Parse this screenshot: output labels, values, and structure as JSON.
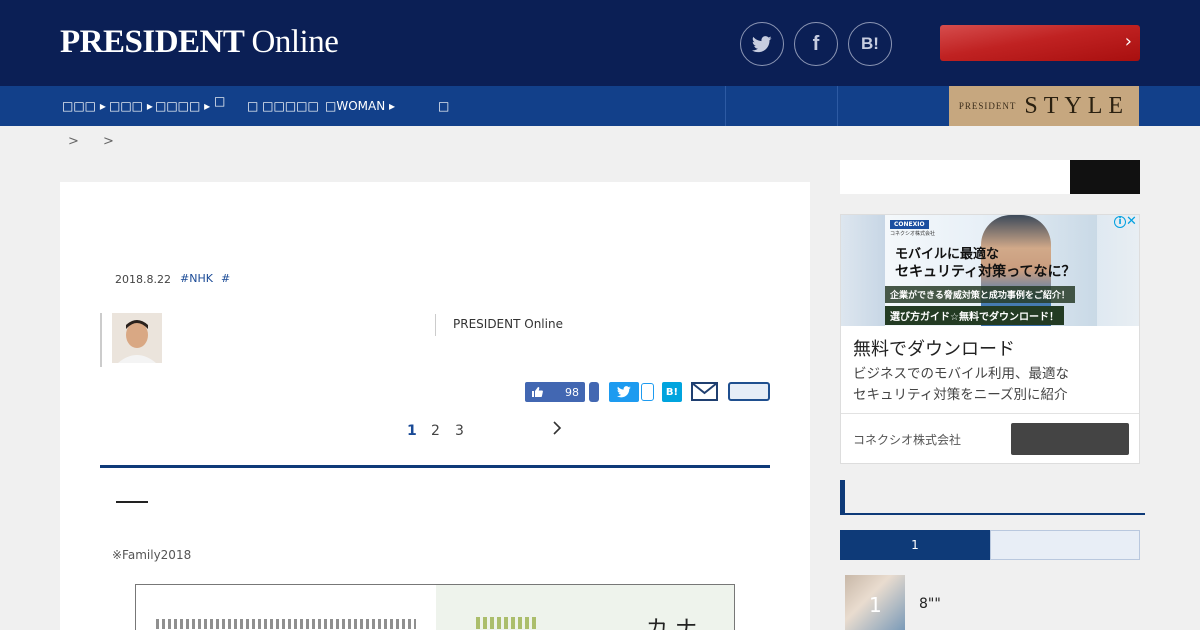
{
  "header": {
    "logo_main": "PRESIDENT",
    "logo_online": "Online",
    "social": [
      {
        "name": "twitter-icon",
        "glyph": "🐦",
        "label": "t"
      },
      {
        "name": "facebook-icon",
        "label": "f"
      },
      {
        "name": "hatena-icon",
        "label": "B!"
      }
    ],
    "subscribe_chevron": "›"
  },
  "nav": {
    "items": [
      {
        "label": "□□□ ▸"
      },
      {
        "label": "□□□ ▸"
      },
      {
        "label": "□□□□ ▸"
      },
      {
        "label": "□"
      },
      {
        "label": "□ □□□□□"
      },
      {
        "label": "□WOMAN ▸"
      },
      {
        "label": "□"
      }
    ],
    "style_prefix": "PRESIDENT",
    "style_word": "STYLE"
  },
  "breadcrumb": [
    ">",
    ">"
  ],
  "article": {
    "date": "2018.8.22",
    "tags": [
      "#NHK",
      "#"
    ],
    "author_org": "PRESIDENT Online",
    "like_count": "98",
    "pages": [
      "1",
      "2",
      "3"
    ],
    "caption": "※Family2018",
    "figure_big_text": "カ ナ"
  },
  "ad": {
    "logo": "CONEXIO",
    "logo_sub": "コネクシオ株式会社",
    "headline_1": "モバイルに最適な",
    "headline_2": "セキュリティ対策ってなに？",
    "band_1": "企業ができる脅威対策と成功事例をご紹介！",
    "band_2": "選び方ガイド☆無料でダウンロード！",
    "title": "無料でダウンロード",
    "desc_1": "ビジネスでのモバイル利用、最適な",
    "desc_2": "セキュリティ対策をニーズ別に紹介",
    "company": "コネクシオ株式会社",
    "info": "i",
    "close": "✕"
  },
  "ranking": {
    "tab_active": "1",
    "item_rank": "1",
    "item_title": "8\"\""
  }
}
